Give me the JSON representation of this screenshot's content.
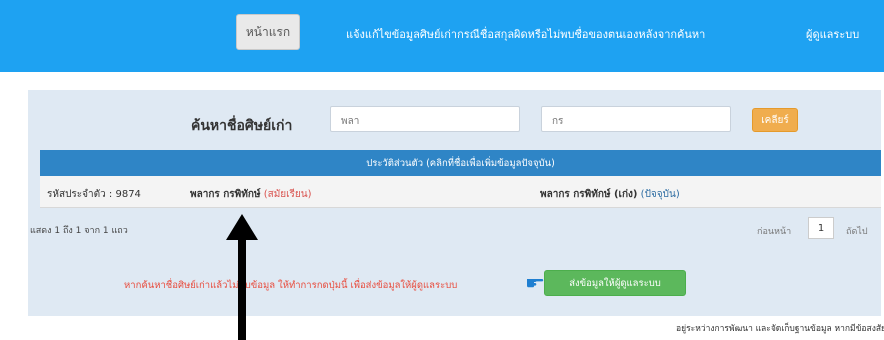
{
  "navbar": {
    "home_label": "หน้าแรก",
    "report_label": "แจ้งแก้ไขข้อมูลศิษย์เก่ากรณีชื่อสกุลผิดหรือไม่พบชื่อของตนเองหลังจากค้นหา",
    "admin_label": "ผู้ดูแลระบบ",
    "bg_color": "#1ea2f2"
  },
  "search": {
    "label": "ค้นหาชื่อศิษย์เก่า",
    "first_name_value": "พลา",
    "last_name_value": "กร",
    "clear_label": "เคลียร์"
  },
  "table": {
    "header": "ประวัติส่วนตัว (คลิกที่ชื่อเพื่อเพิ่มข้อมูลปัจจุบัน)",
    "rows": [
      {
        "id_text": "รหัสประจำตัว : 9874",
        "name_then": "พลากร กรพิทักษ์",
        "then_tag": "(สมัยเรียน)",
        "name_now": "พลากร กรพิทักษ์ (เก่ง)",
        "now_tag": "(ปัจจุบัน)"
      }
    ]
  },
  "pagination": {
    "showing_text": "แสดง 1 ถึง 1 จาก 1 แถว",
    "prev_label": "ก่อนหน้า",
    "current_page": "1",
    "next_label": "ถัดไป"
  },
  "notice": {
    "text": "หากค้นหาชื่อศิษย์เก่าแล้วไม่พบข้อมูล ให้ทำการกดปุ่มนี้ เพื่อส่งข้อมูลให้ผู้ดูแลระบบ",
    "icon": "pointing-hand-icon",
    "send_label": "ส่งข้อมูลให้ผู้ดูแลระบบ"
  },
  "footer": {
    "text": "อยู่ระหว่างการพัฒนา และจัดเก็บฐานข้อมูล หากมีข้อสงสัย"
  },
  "colors": {
    "table_header": "#2f85c6",
    "clear_button": "#f0ad4e",
    "send_button": "#5cb85c",
    "notice_text": "#e84c3d",
    "panel_bg": "#dfe9f3"
  }
}
